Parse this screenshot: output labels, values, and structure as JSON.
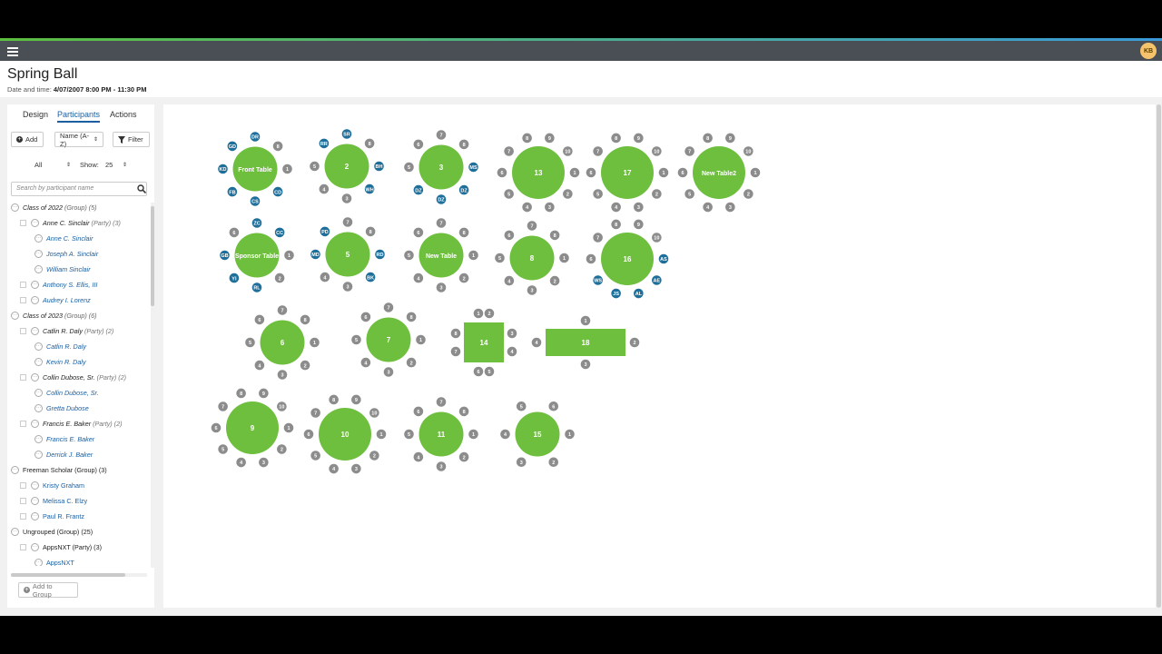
{
  "app": {
    "user_initials": "KB"
  },
  "event": {
    "title": "Spring Ball",
    "datetime_label": "Date and time:",
    "datetime_value": "4/07/2007 8:00 PM - 11:30 PM"
  },
  "tabs": {
    "design": "Design",
    "participants": "Participants",
    "actions": "Actions"
  },
  "toolbar": {
    "add_label": "Add",
    "sort_value": "Name (A-Z)",
    "filter_label": "Filter",
    "all_value": "All",
    "show_label": "Show:",
    "show_value": "25"
  },
  "search": {
    "placeholder": "Search by participant name"
  },
  "tree": [
    {
      "kind": "group",
      "name": "Class of 2022",
      "suffix": "(Group) (5)"
    },
    {
      "kind": "party",
      "name": "Anne C. Sinclair",
      "suffix": "(Party) (3)"
    },
    {
      "kind": "person",
      "name": "Anne C. Sinclair"
    },
    {
      "kind": "person",
      "name": "Joseph A. Sinclair"
    },
    {
      "kind": "person",
      "name": "William Sinclair"
    },
    {
      "kind": "single",
      "name": "Anthony S. Ellis, III"
    },
    {
      "kind": "single",
      "name": "Audrey I. Lorenz"
    },
    {
      "kind": "group",
      "name": "Class of 2023",
      "suffix": "(Group) (6)"
    },
    {
      "kind": "party",
      "name": "Catlin R. Daly",
      "suffix": "(Party) (2)"
    },
    {
      "kind": "person",
      "name": "Catlin R. Daly"
    },
    {
      "kind": "person",
      "name": "Kevin R. Daly"
    },
    {
      "kind": "party",
      "name": "Collin Dubose, Sr.",
      "suffix": "(Party) (2)"
    },
    {
      "kind": "person",
      "name": "Collin Dubose, Sr."
    },
    {
      "kind": "person",
      "name": "Gretta Dubose"
    },
    {
      "kind": "party",
      "name": "Francis E. Baker",
      "suffix": "(Party) (2)"
    },
    {
      "kind": "person",
      "name": "Francis E. Baker"
    },
    {
      "kind": "person",
      "name": "Derrick J. Baker"
    },
    {
      "kind": "groupplain",
      "name": "Freeman Scholar (Group) (3)"
    },
    {
      "kind": "singleplain",
      "name": "Kristy Graham"
    },
    {
      "kind": "singleplain",
      "name": "Melissa C. Elzy"
    },
    {
      "kind": "singleplain",
      "name": "Paul R. Frantz"
    },
    {
      "kind": "groupplain",
      "name": "Ungrouped (Group) (25)"
    },
    {
      "kind": "partyplain",
      "name": "AppsNXT (Party) (3)"
    },
    {
      "kind": "personplain",
      "name": "AppsNXT"
    }
  ],
  "add_to_group": "Add to Group",
  "colors": {
    "table": "#6fbf3f",
    "seat_empty": "#8c8c8c",
    "seat_filled": "#1f6f9b"
  },
  "tables": [
    {
      "label": "Front Table",
      "shape": "round",
      "size": "m",
      "seats": [
        "1",
        "CD",
        "CS",
        "FB",
        "KD",
        "GD",
        "DR",
        "8"
      ]
    },
    {
      "label": "2",
      "shape": "round",
      "size": "m",
      "seats": [
        "BH",
        "WH",
        "3",
        "4",
        "5",
        "RR",
        "SR",
        "8"
      ]
    },
    {
      "label": "3",
      "shape": "round",
      "size": "m",
      "seats": [
        "MS",
        "DZ",
        "DZ",
        "DZ",
        "5",
        "6",
        "7",
        "8"
      ]
    },
    {
      "label": "13",
      "shape": "round",
      "size": "l",
      "seats": [
        "1",
        "2",
        "3",
        "4",
        "5",
        "6",
        "7",
        "8",
        "9",
        "10"
      ]
    },
    {
      "label": "17",
      "shape": "round",
      "size": "l",
      "seats": [
        "1",
        "2",
        "3",
        "4",
        "5",
        "6",
        "7",
        "8",
        "9",
        "10"
      ]
    },
    {
      "label": "New Table2",
      "shape": "round",
      "size": "l",
      "seats": [
        "1",
        "2",
        "3",
        "4",
        "5",
        "6",
        "7",
        "8",
        "9",
        "10"
      ]
    },
    {
      "label": "Sponsor Table",
      "shape": "round",
      "size": "m",
      "seats": [
        "1",
        "2",
        "RL",
        "YI",
        "GB",
        "6",
        "ZC",
        "CC"
      ]
    },
    {
      "label": "5",
      "shape": "round",
      "size": "m",
      "seats": [
        "RD",
        "BK",
        "3",
        "4",
        "MD",
        "PD",
        "7",
        "8"
      ]
    },
    {
      "label": "New Table",
      "shape": "round",
      "size": "m",
      "seats": [
        "1",
        "2",
        "3",
        "4",
        "5",
        "6",
        "7",
        "8"
      ]
    },
    {
      "label": "8",
      "shape": "round",
      "size": "m",
      "seats": [
        "1",
        "2",
        "3",
        "4",
        "5",
        "6",
        "7",
        "8"
      ]
    },
    {
      "label": "16",
      "shape": "round",
      "size": "l",
      "seats": [
        "AS",
        "AE",
        "AL",
        "JS",
        "WS",
        "6",
        "7",
        "8",
        "9",
        "10"
      ]
    },
    {
      "label": "6",
      "shape": "round",
      "size": "m",
      "seats": [
        "1",
        "2",
        "3",
        "4",
        "5",
        "6",
        "7",
        "8"
      ]
    },
    {
      "label": "7",
      "shape": "round",
      "size": "m",
      "seats": [
        "1",
        "2",
        "3",
        "4",
        "5",
        "6",
        "7",
        "8"
      ]
    },
    {
      "label": "14",
      "shape": "square",
      "seats": [
        "1",
        "2",
        "3",
        "4",
        "5",
        "6",
        "7",
        "8"
      ]
    },
    {
      "label": "18",
      "shape": "rect",
      "seats": [
        "1",
        "2",
        "3",
        "4"
      ]
    },
    {
      "label": "9",
      "shape": "round",
      "size": "l",
      "seats": [
        "1",
        "2",
        "3",
        "4",
        "5",
        "6",
        "7",
        "8",
        "9",
        "10"
      ]
    },
    {
      "label": "10",
      "shape": "round",
      "size": "l",
      "seats": [
        "1",
        "2",
        "3",
        "4",
        "5",
        "6",
        "7",
        "8",
        "9",
        "10"
      ]
    },
    {
      "label": "11",
      "shape": "round",
      "size": "m",
      "seats": [
        "1",
        "2",
        "3",
        "4",
        "5",
        "6",
        "7",
        "8"
      ]
    },
    {
      "label": "15",
      "shape": "round",
      "size": "m",
      "seats": [
        "1",
        "2",
        "3",
        "4",
        "5",
        "6"
      ]
    }
  ]
}
